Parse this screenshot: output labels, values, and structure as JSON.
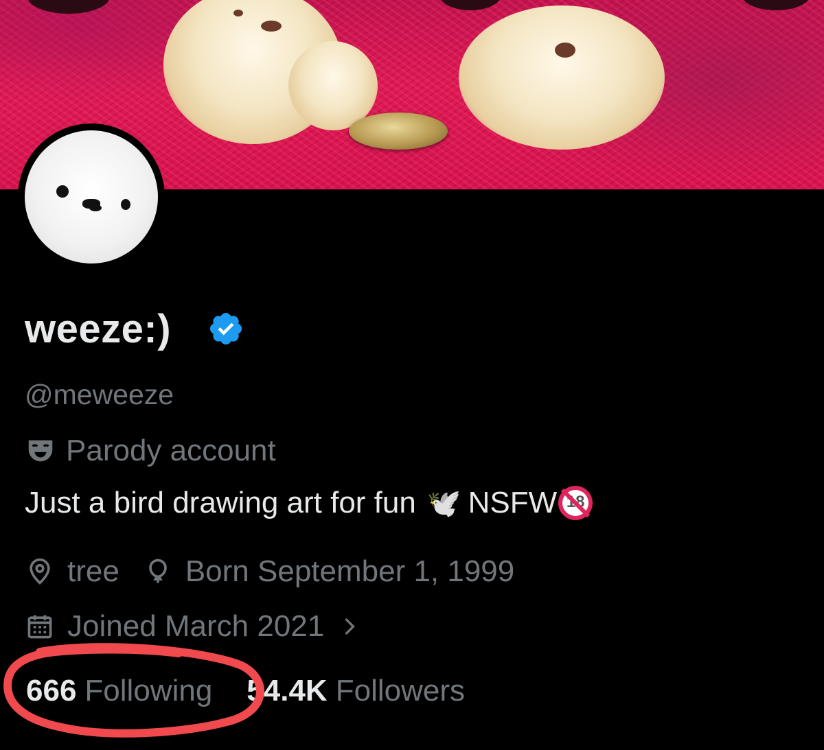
{
  "profile": {
    "display_name": "weeze:)",
    "handle": "@meweeze",
    "parody_label": "Parody account",
    "bio_text": "Just a bird drawing art for fun",
    "bio_emoji": "🕊️",
    "bio_suffix": "NSFW",
    "location": "tree",
    "birthday": "Born September 1, 1999",
    "joined": "Joined March 2021",
    "following_count": "666",
    "following_label": "Following",
    "followers_count": "54.4K",
    "followers_label": "Followers"
  },
  "badges": {
    "under18_top": "UNDER",
    "under18_num": "18"
  },
  "icons": {
    "verified": "verified-badge-icon",
    "parody": "theater-mask-icon",
    "location": "location-pin-icon",
    "birthday": "balloon-icon",
    "joined": "calendar-icon",
    "chevron": "chevron-right-icon"
  },
  "colors": {
    "verified_blue": "#1d9bf0",
    "secondary_text": "#71767b",
    "primary_text": "#e7e9ea",
    "annotation_red": "#f0494e"
  }
}
